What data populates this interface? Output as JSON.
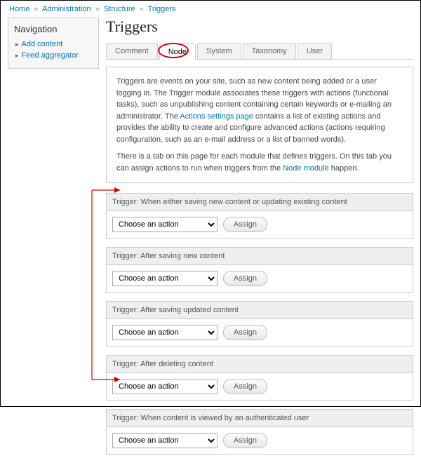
{
  "breadcrumb": {
    "home": "Home",
    "administration": "Administration",
    "structure": "Structure",
    "triggers": "Triggers"
  },
  "sidebar": {
    "title": "Navigation",
    "items": [
      {
        "label": "Add content"
      },
      {
        "label": "Feed aggregator"
      }
    ]
  },
  "page": {
    "title": "Triggers"
  },
  "tabs": [
    {
      "label": "Comment",
      "active": false
    },
    {
      "label": "Node",
      "active": true
    },
    {
      "label": "System",
      "active": false
    },
    {
      "label": "Taxonomy",
      "active": false
    },
    {
      "label": "User",
      "active": false
    }
  ],
  "description": {
    "p1a": "Triggers are events on your site, such as new content being added or a user logging in. The Trigger module associates these triggers with actions (functional tasks), such as unpublishing content containing certain keywords or e-mailing an administrator. The ",
    "p1link": "Actions settings page",
    "p1b": " contains a list of existing actions and provides the ability to create and configure advanced actions (actions requiring configuration, such as an e-mail address or a list of banned words).",
    "p2a": "There is a tab on this page for each module that defines triggers. On this tab you can assign actions to run when triggers from the ",
    "p2link": "Node module",
    "p2b": " happen."
  },
  "triggers": {
    "select_label": "Choose an action",
    "assign_label": "Assign",
    "blocks": [
      {
        "title": "Trigger: When either saving new content or updating existing content"
      },
      {
        "title": "Trigger: After saving new content"
      },
      {
        "title": "Trigger: After saving updated content"
      },
      {
        "title": "Trigger: After deleting content"
      },
      {
        "title": "Trigger: When content is viewed by an authenticated user"
      }
    ]
  }
}
